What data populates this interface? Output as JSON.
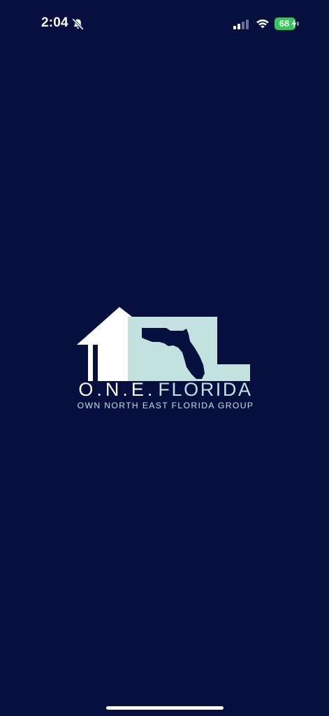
{
  "status_bar": {
    "time": "2:04",
    "battery_level": "68",
    "icons": [
      "bell-slash-icon",
      "cellular-signal-icon",
      "wifi-icon",
      "battery-icon",
      "charging-bolt-icon"
    ]
  },
  "logo": {
    "brand_prefix": "O.N.E.",
    "brand_word": "FLORIDA",
    "tagline": "OWN NORTH EAST FLORIDA GROUP"
  },
  "colors": {
    "background": "#060f3d",
    "logo_white": "#ffffff",
    "logo_teal": "#c3e1df",
    "battery_green": "#34c759"
  }
}
